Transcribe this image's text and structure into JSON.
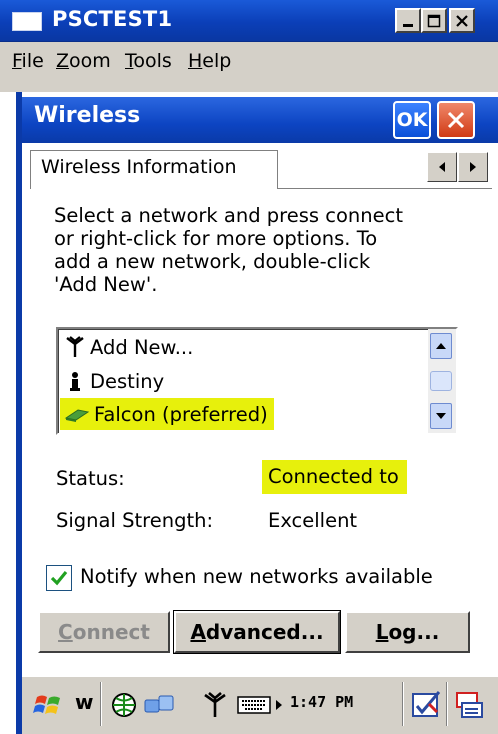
{
  "window": {
    "title": "PSCTEST1"
  },
  "menu": [
    {
      "first": "F",
      "rest": "ile"
    },
    {
      "first": "Z",
      "rest": "oom"
    },
    {
      "first": "T",
      "rest": "ools"
    },
    {
      "first": "H",
      "rest": "elp"
    }
  ],
  "dialog": {
    "title": "Wireless",
    "ok_label": "OK"
  },
  "tab": {
    "label": "Wireless Information"
  },
  "instructions": "Select a network and press connect\nor right-click for more options.  To\nadd a new network, double-click\n'Add New'.",
  "networks": [
    {
      "label": "Add New...",
      "icon": "antenna-icon",
      "highlighted": false
    },
    {
      "label": "Destiny",
      "icon": "adhoc-network-icon",
      "highlighted": false
    },
    {
      "label": "Falcon (preferred)",
      "icon": "wireless-card-icon",
      "highlighted": true
    }
  ],
  "status": {
    "label": "Status:",
    "value": "Connected to"
  },
  "signal": {
    "label": "Signal Strength:",
    "value": "Excellent"
  },
  "notify": {
    "label": "Notify when new networks available",
    "checked": true
  },
  "buttons": {
    "connect": {
      "first": "C",
      "rest": "onnect",
      "enabled": false
    },
    "advanced": {
      "first": "A",
      "rest": "dvanced..."
    },
    "log": {
      "first": "L",
      "rest": "og..."
    }
  },
  "taskbar": {
    "w_label": "w",
    "clock": "1:47 PM"
  },
  "colors": {
    "titlebar": "#0b3fb8",
    "highlight": "#e7f00c",
    "face": "#d4d0c8"
  }
}
